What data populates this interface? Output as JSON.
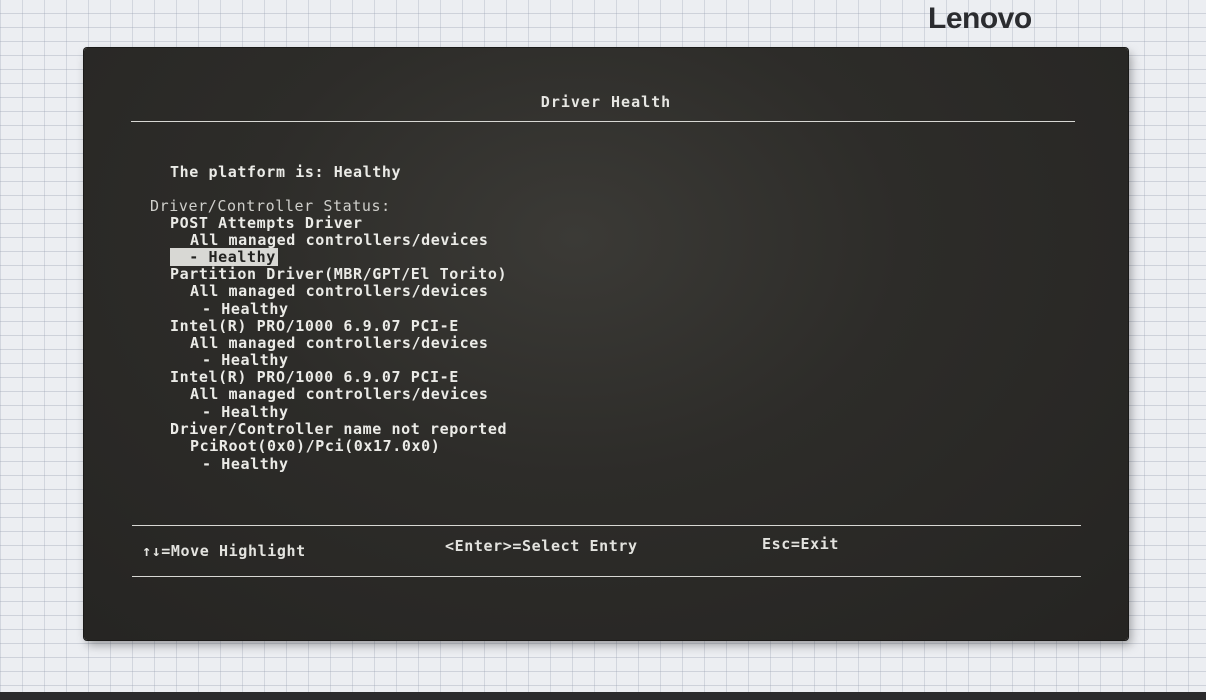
{
  "brand": {
    "logo_text": "Lenovo"
  },
  "screen": {
    "title": "Driver Health",
    "platform_status": "The platform is: Healthy",
    "status_header": "Driver/Controller Status:",
    "entries": [
      {
        "driver": "POST Attempts Driver",
        "device": "All managed controllers/devices",
        "status": "- Healthy"
      },
      {
        "driver": "Partition Driver(MBR/GPT/El Torito)",
        "device": "All managed controllers/devices",
        "status": "- Healthy"
      },
      {
        "driver": "Intel(R) PRO/1000 6.9.07 PCI-E",
        "device": "All managed controllers/devices",
        "status": "- Healthy"
      },
      {
        "driver": "Intel(R) PRO/1000 6.9.07 PCI-E",
        "device": "All managed controllers/devices",
        "status": "- Healthy"
      },
      {
        "driver": "Driver/Controller name not reported",
        "device": "PciRoot(0x0)/Pci(0x17.0x0)",
        "status": "- Healthy"
      }
    ],
    "selected_entry_index": 0
  },
  "footer": {
    "move_hint": "↑↓=Move Highlight",
    "select_hint": "<Enter>=Select Entry",
    "exit_hint": "Esc=Exit"
  }
}
